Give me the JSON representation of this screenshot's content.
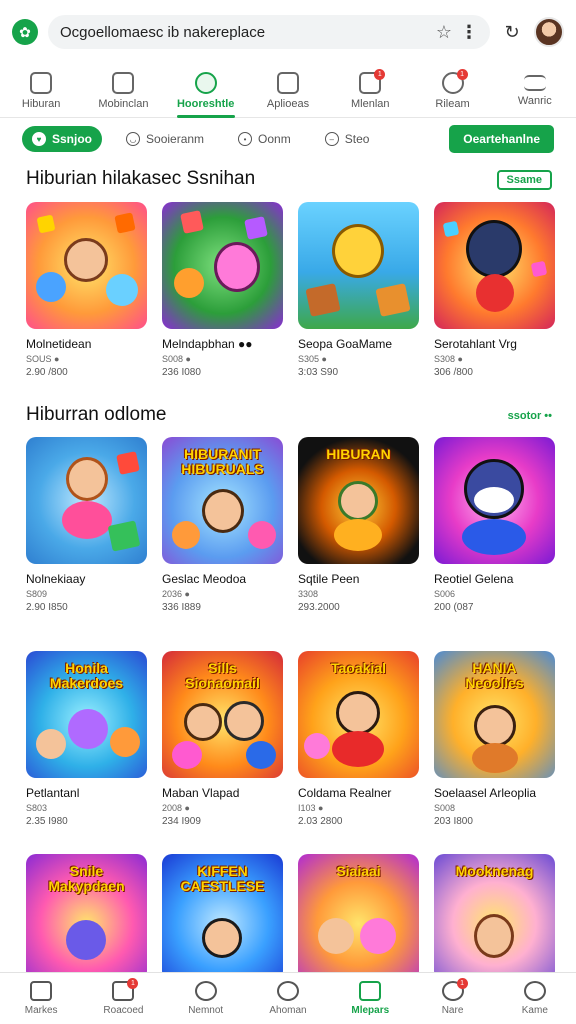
{
  "browser": {
    "url": "Ocgoellomaesc ib nakereplace"
  },
  "categories": [
    {
      "label": "Hiburan",
      "icon": "store-icon",
      "active": false
    },
    {
      "label": "Mobinclan",
      "icon": "apps-icon",
      "active": false
    },
    {
      "label": "Hooreshtle",
      "icon": "clock-icon",
      "active": true
    },
    {
      "label": "Aplioeas",
      "icon": "puzzle-icon",
      "active": false
    },
    {
      "label": "Mlenlan",
      "icon": "chat-icon",
      "active": false,
      "badge": "1"
    },
    {
      "label": "Rileam",
      "icon": "person-icon",
      "active": false,
      "badge": "1"
    },
    {
      "label": "Wanric",
      "icon": "menu-icon",
      "active": false
    }
  ],
  "filters": [
    {
      "label": "Ssnjoo",
      "icon": "heart-icon",
      "active": true
    },
    {
      "label": "Sooieranm",
      "icon": "smile-icon",
      "active": false
    },
    {
      "label": "Oonm",
      "icon": "circle-icon",
      "active": false
    },
    {
      "label": "Steo",
      "icon": "minus-icon",
      "active": false
    }
  ],
  "cta_label": "Oeartehanlne",
  "sections": [
    {
      "title": "Hiburian hilakasec Ssnihan",
      "see_all": "Ssame",
      "items": [
        {
          "title": "Molnetidean",
          "sub": "SOUS ●",
          "price": "2.90 /800"
        },
        {
          "title": "Melndapbhan ●●",
          "sub": "S008 ●",
          "price": "236 I080"
        },
        {
          "title": "Seopa GoaMame",
          "sub": "S305 ●",
          "price": "3:03 S90"
        },
        {
          "title": "Serotahlant Vrg",
          "sub": "S308 ●",
          "price": "306 /800"
        }
      ]
    },
    {
      "title": "Hiburran odlome",
      "see_all": "ssotor ••",
      "items": [
        {
          "title": "Nolnekiaay",
          "sub": "S809",
          "price": "2.90 I850",
          "banner": ""
        },
        {
          "title": "Geslac Meodoa",
          "sub": "2036 ●",
          "price": "336 I889",
          "banner": "HIBURANIT HIBURUALS"
        },
        {
          "title": "Sqtile Peen",
          "sub": "3308",
          "price": "293.2000",
          "banner": "HIBURAN"
        },
        {
          "title": "Reotiel Gelena",
          "sub": "S006",
          "price": "200 (087",
          "banner": ""
        }
      ]
    }
  ],
  "row3": [
    {
      "title": "Petlantanl",
      "sub": "S803",
      "price": "2.35 I980",
      "banner": "Honila Makerdoes"
    },
    {
      "title": "Maban Vlapad",
      "sub": "2008 ●",
      "price": "234 I909",
      "banner": "Sills Sionaomail"
    },
    {
      "title": "Coldama Realner",
      "sub": "I103 ●",
      "price": "2.03 2800",
      "banner": "Taoakial"
    },
    {
      "title": "Soelaasel Arleoplia",
      "sub": "S008",
      "price": "203 I800",
      "banner": "HANIA Neoolles"
    }
  ],
  "row4_banners": [
    "Snile Makypdaen",
    "KIFFEN CAESTLESE",
    "Siaiaai",
    "Mooknenag"
  ],
  "bottom_nav": [
    {
      "label": "Markes",
      "icon": "home-icon",
      "active": false
    },
    {
      "label": "Roacoed",
      "icon": "grid-icon",
      "active": false,
      "badge": "1"
    },
    {
      "label": "Nemnot",
      "icon": "compass-icon",
      "active": false
    },
    {
      "label": "Ahoman",
      "icon": "headphones-icon",
      "active": false
    },
    {
      "label": "Mlepars",
      "icon": "bookmark-icon",
      "active": true
    },
    {
      "label": "Nare",
      "icon": "chat-bubble-icon",
      "active": false,
      "badge": "1"
    },
    {
      "label": "Kame",
      "icon": "profile-icon",
      "active": false
    }
  ],
  "colors": {
    "accent": "#16a34a",
    "badge": "#e53935"
  }
}
